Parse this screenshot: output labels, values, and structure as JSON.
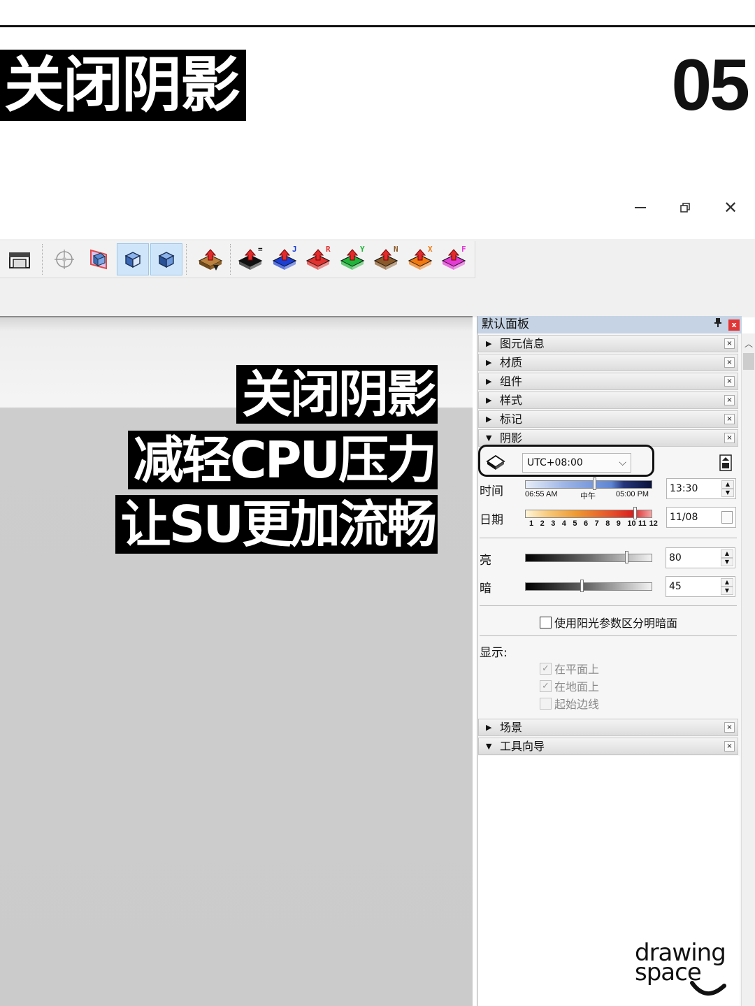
{
  "header": {
    "title": "关闭阴影",
    "number": "05"
  },
  "window_controls": {
    "minimize": "–",
    "restore": "❐",
    "close": "✕"
  },
  "toolbar": {
    "icons": [
      "warehouse-icon",
      "orbit-icon",
      "section-plane-icon",
      "section-cut-icon",
      "section-fill-icon",
      "push-arrow-icon",
      "push-e-icon",
      "push-j-icon",
      "push-r-icon",
      "push-y-icon",
      "push-n-icon",
      "push-x-icon",
      "push-f-icon"
    ],
    "push_letters": [
      "=",
      "J",
      "R",
      "Y",
      "N",
      "X",
      "F"
    ],
    "push_colors": [
      "#111111",
      "#1a3fd6",
      "#e0322f",
      "#1fb53a",
      "#8a5a2a",
      "#f07a10",
      "#e43ad6"
    ]
  },
  "captions": [
    "关闭阴影",
    "减轻CPU压力",
    "让SU更加流畅"
  ],
  "tray": {
    "title": "默认面板",
    "pin": "ᚂ",
    "close": "x",
    "panels": [
      "图元信息",
      "材质",
      "组件",
      "样式",
      "标记",
      "阴影"
    ],
    "bottom_panels": [
      "场景",
      "工具向导"
    ],
    "x_label": "×"
  },
  "shadows": {
    "timezone": "UTC+08:00",
    "time_label": "时间",
    "time_value": "13:30",
    "time_ticks": [
      "06:55 AM",
      "中午",
      "05:00 PM"
    ],
    "time_fraction": 0.55,
    "date_label": "日期",
    "date_value": "11/08",
    "date_ticks": [
      "1",
      "2",
      "3",
      "4",
      "5",
      "6",
      "7",
      "8",
      "9",
      "10",
      "11",
      "12"
    ],
    "date_fraction": 0.87,
    "light_label": "亮",
    "light_value": "80",
    "dark_label": "暗",
    "dark_value": "45",
    "use_sun_label": "使用阳光参数区分明暗面",
    "display_label": "显示:",
    "display_options": [
      "在平面上",
      "在地面上",
      "起始边线"
    ],
    "display_checked": [
      true,
      true,
      false
    ]
  },
  "logo": {
    "line1": "drawing",
    "line2": "space"
  }
}
